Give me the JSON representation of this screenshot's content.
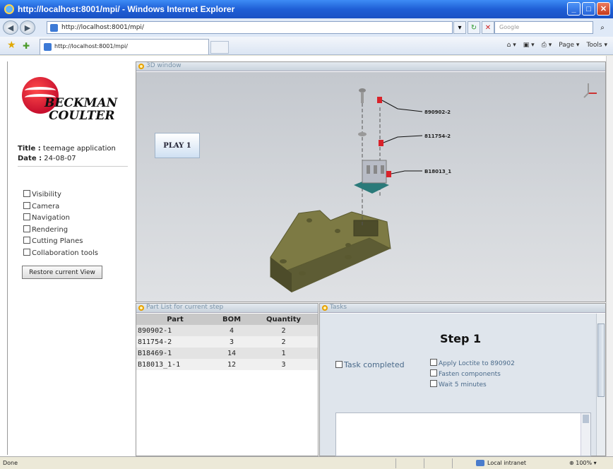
{
  "browser": {
    "title": "http://localhost:8001/mpi/ - Windows Internet Explorer",
    "address": "http://localhost:8001/mpi/",
    "search_placeholder": "Google",
    "tab_title": "http://localhost:8001/mpi/",
    "page_menu": "Page",
    "tools_menu": "Tools",
    "status_text": "Done",
    "zone_text": "Local intranet",
    "zoom_text": "100%"
  },
  "sidebar": {
    "logo_line1": "BECKMAN",
    "logo_line2": "COULTER",
    "title_label": "Title :",
    "title_value": "teemage application",
    "date_label": "Date :",
    "date_value": "24-08-07",
    "options": [
      "Visibility",
      "Camera",
      "Navigation",
      "Rendering",
      "Cutting Planes",
      "Collaboration tools"
    ],
    "restore_button": "Restore current View"
  },
  "view3d": {
    "header": "3D window",
    "play_button": "PLAY 1",
    "callouts": [
      "890902-2",
      "811754-2",
      "B18013_1"
    ]
  },
  "partlist": {
    "header": "Part List for current step",
    "columns": [
      "Part",
      "BOM",
      "Quantity"
    ],
    "rows": [
      [
        "890902-1",
        "4",
        "2"
      ],
      [
        "811754-2",
        "3",
        "2"
      ],
      [
        "B18469-1",
        "14",
        "1"
      ],
      [
        "B18013_1-1",
        "12",
        "3"
      ]
    ]
  },
  "tasks": {
    "header": "Tasks",
    "step_title": "Step 1",
    "task_completed": "Task completed",
    "subtasks": [
      "Apply Loctite to 890902",
      "Fasten components",
      "Wait 5 minutes"
    ]
  },
  "colors": {
    "accent": "#1f5fd6",
    "brand_red": "#c8102e",
    "part_green": "#6b6a3a"
  }
}
